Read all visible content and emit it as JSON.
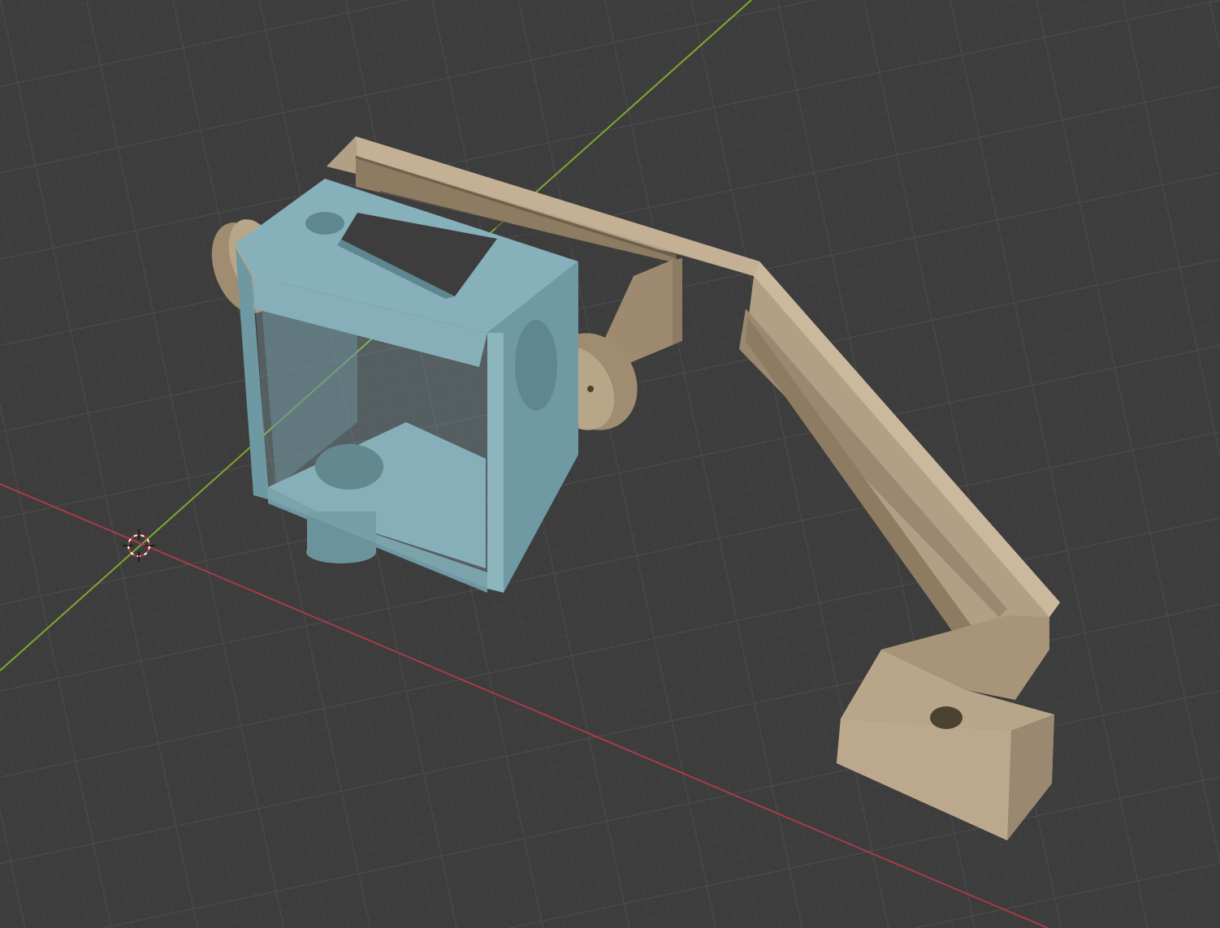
{
  "viewport": {
    "name": "3D Viewport",
    "background": "#3d3d3d",
    "grid_minor_color": "#474747",
    "grid_major_color": "#535353",
    "x_axis_color": "#b33a4a",
    "y_axis_color": "#7fa830"
  },
  "objects": [
    {
      "id": "camera-cage",
      "color": "#7fa9b3",
      "shade_dark": "#5f8790",
      "shade_light": "#a3c5cc"
    },
    {
      "id": "mount-bracket",
      "color": "#b29f85",
      "shade_dark": "#8d7b62",
      "shade_light": "#cdbb9f"
    }
  ],
  "cursor": {
    "icon": "3d-cursor-icon"
  }
}
